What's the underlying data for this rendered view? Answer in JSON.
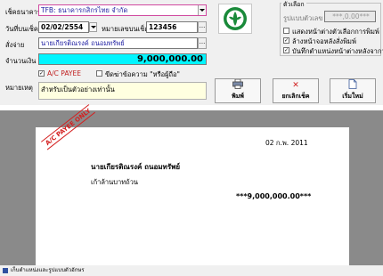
{
  "form": {
    "bank_label": "เช็คธนาคาร",
    "bank_value": "TFB: ธนาคารกสิกรไทย จำกัด",
    "date_label": "วันที่บนเช็ค",
    "date_value": "02/02/2554",
    "cheque_no_label": "หมายเลขบนเช็ค",
    "cheque_no_value": "123456",
    "payee_label": "สั่งจ่าย",
    "payee_value": "นายเกียรติณรงค์ ถนอมทรัพย์",
    "amount_label": "จำนวนเงิน",
    "amount_value": "9,000,000.00",
    "ac_payee_label": "A/C PAYEE",
    "ac_payee_checked": true,
    "strike_bearer_label": "ขีดฆ่าข้อความ \"หรือผู้ถือ\"",
    "strike_bearer_checked": false,
    "remark_label": "หมายเหตุ",
    "remark_value": "สำหรับเป็นตัวอย่างเท่านั้น"
  },
  "options": {
    "title": "ตัวเลือก",
    "format_label": "รูปแบบตัวเลข",
    "format_value": "***,0.00***",
    "items": [
      {
        "label": "แสดงหน้าต่างตัวเลือกการพิมพ์",
        "checked": false
      },
      {
        "label": "ล้างหน้าจอหลังสั่งพิมพ์",
        "checked": true
      },
      {
        "label": "บันทึกตำแหน่งหน้าต่างหลังจากวาง",
        "checked": true
      }
    ]
  },
  "buttons": {
    "print": {
      "label": "พิมพ์",
      "icon": "printer-icon"
    },
    "cancel": {
      "label": "ยกเลิกเช็ค",
      "icon": "cancel-icon"
    },
    "new": {
      "label": "เริ่มใหม่",
      "icon": "new-document-icon"
    }
  },
  "colors": {
    "amount_bg": "#00f5ff",
    "combo_border": "#d04aa0",
    "stamp": "#d42020",
    "logo_green": "#1a8a3a"
  },
  "preview": {
    "stamp_text": "A/C PAYEE ONLY",
    "date": "02 ก.พ. 2011",
    "payee": "นายเกียรติณรงค์ ถนอมทรัพย์",
    "amount_words": "เก้าล้านบาทถ้วน",
    "amount": "***9,000,000.00***"
  },
  "status_bar": {
    "text": "เก็บตำแหน่งและรูปแบบตัวอักษร"
  }
}
